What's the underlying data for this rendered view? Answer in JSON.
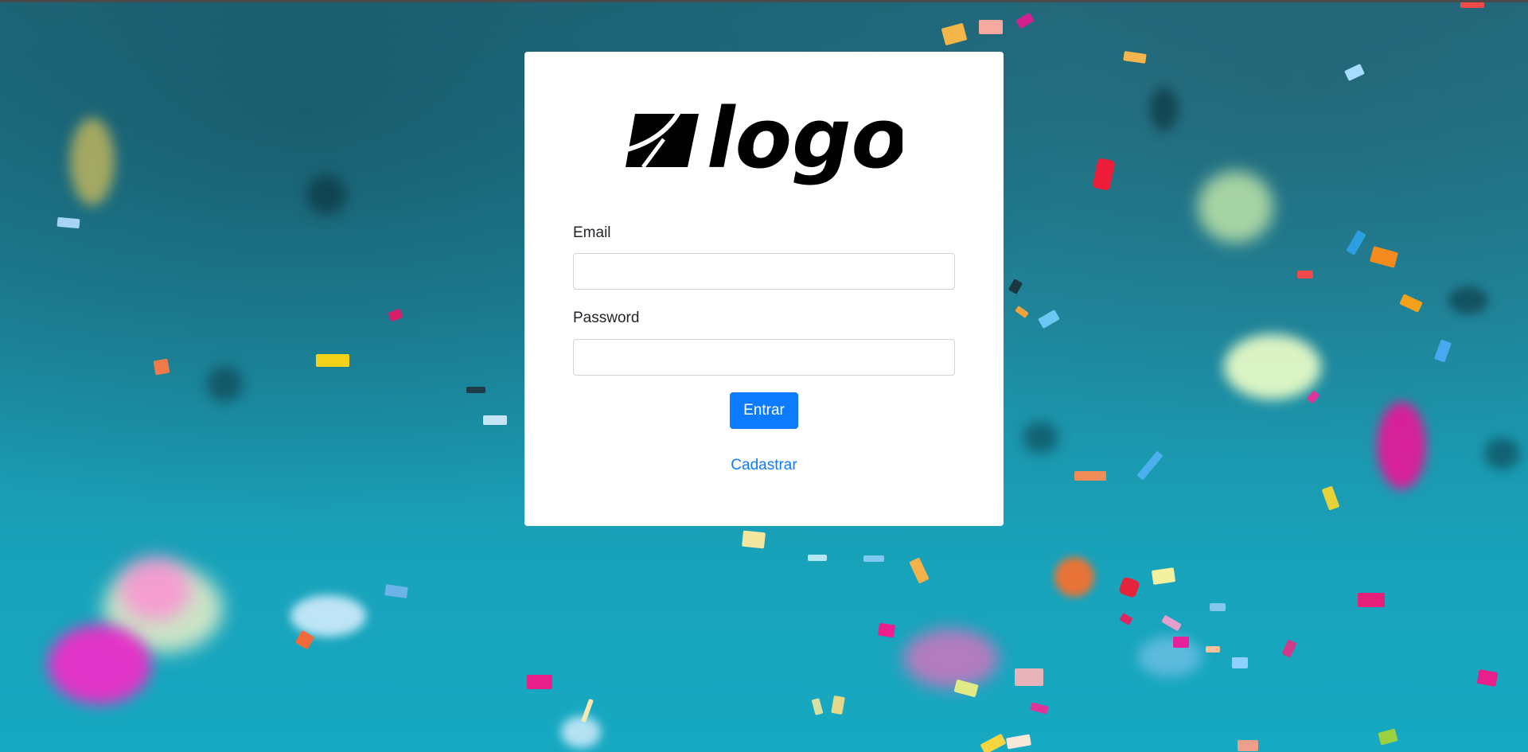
{
  "login": {
    "email_label": "Email",
    "email_value": "",
    "password_label": "Password",
    "password_value": "",
    "submit_label": "Entrar",
    "register_link": "Cadastrar"
  },
  "colors": {
    "primary": "#0d7bff",
    "card": "#ffffff",
    "background": "#1e8aa0"
  },
  "logo_text": "logo"
}
